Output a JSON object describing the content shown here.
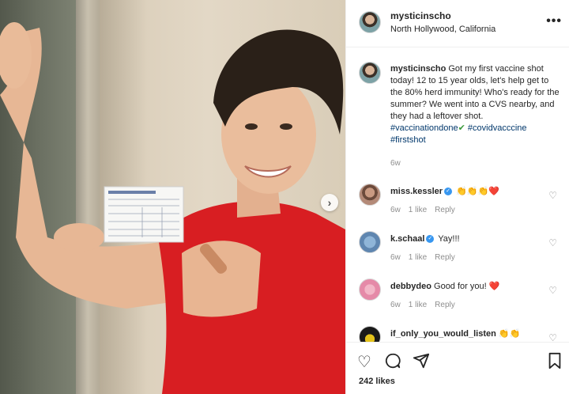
{
  "post": {
    "username": "mysticinscho",
    "location": "North Hollywood, California",
    "more_icon": "more-icon",
    "caption": {
      "username": "mysticinscho",
      "text": " Got my first vaccine shot today! 12 to 15 year olds, let's help get to the 80% herd immunity! Who's ready for the summer? We went into a CVS nearby, and they had a leftover shot. ",
      "tags": [
        "#vaccinationdone",
        "#covidvacccine",
        "#firstshot"
      ],
      "check": "✔",
      "age": "6w"
    },
    "comments": [
      {
        "username": "miss.kessler",
        "verified": true,
        "text": "",
        "emojis": "👏👏👏❤️",
        "age": "6w",
        "likes": "1 like",
        "reply": "Reply"
      },
      {
        "username": "k.schaal",
        "verified": true,
        "text": "Yay!!!",
        "emojis": "",
        "age": "6w",
        "likes": "1 like",
        "reply": "Reply"
      },
      {
        "username": "debbydeo",
        "verified": false,
        "text": "Good for you!",
        "emojis": "❤️",
        "age": "6w",
        "likes": "1 like",
        "reply": "Reply"
      },
      {
        "username": "if_only_you_would_listen",
        "verified": false,
        "text": "",
        "emojis": "👏👏",
        "age": "",
        "likes": "",
        "reply": ""
      }
    ],
    "likes": "242 likes",
    "actions": [
      "heart-icon",
      "comment-icon",
      "share-icon",
      "bookmark-icon"
    ]
  },
  "photo": {
    "description_icon": "next-arrow-icon",
    "next_label": "›"
  },
  "colors": {
    "link": "#00376b",
    "meta": "#8e8e8e",
    "verified": "#3897f0"
  }
}
